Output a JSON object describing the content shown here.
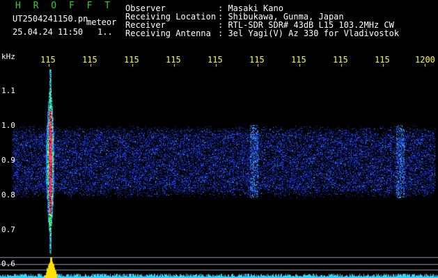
{
  "header": {
    "brand": "H R O F F T",
    "file": "UT2504241150.pn",
    "tag": "meteor",
    "datetime": "25.04.24 11:50",
    "extra": "1..",
    "rows": [
      {
        "label": "Observer",
        "value": ": Masaki Kano"
      },
      {
        "label": "Receiving Location",
        "value": ": Shibukawa, Gunma, Japan"
      },
      {
        "label": "Receiver",
        "value": ": RTL-SDR SDR# 43dB L15 103.2MHz CW"
      },
      {
        "label": "Receiving Antenna",
        "value": ": 3el Yagi(V) Az 330 for Vladivostok"
      }
    ]
  },
  "axes": {
    "y_unit": "kHz",
    "time_ticks": [
      "115",
      "115",
      "115",
      "115",
      "115",
      "115",
      "115",
      "115",
      "115",
      "1200"
    ],
    "freq_ticks": [
      "1.1",
      "1.0",
      "0.9",
      "0.8",
      "0.7",
      "0.6"
    ]
  },
  "colors": {
    "background": "#000000",
    "time_label": "#ffff33",
    "axis_label": "#ffffff",
    "brand": "#2fd12f",
    "noise": "#1a3cff",
    "meteor_core": "#ff1a5a",
    "spectrum": "#33d6ff",
    "spike": "#ffe000"
  }
}
